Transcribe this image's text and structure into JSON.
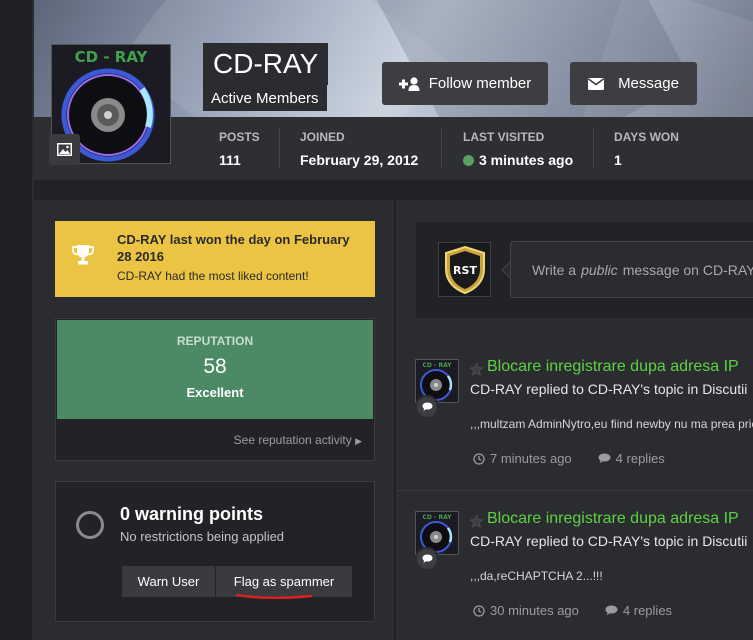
{
  "profile": {
    "name": "CD-RAY",
    "group": "Active Members",
    "avatar_text": "CD - RAY"
  },
  "header": {
    "follow_label": "Follow member",
    "message_label": "Message"
  },
  "stats": [
    {
      "label": "POSTS",
      "value": "111"
    },
    {
      "label": "JOINED",
      "value": "February 29, 2012"
    },
    {
      "label": "LAST VISITED",
      "value": "3 minutes ago"
    },
    {
      "label": "DAYS WON",
      "value": "1"
    }
  ],
  "won": {
    "title": "CD-RAY last won the day on February 28 2016",
    "subtitle": "CD-RAY had the most liked content!"
  },
  "reputation": {
    "label": "REPUTATION",
    "value": "58",
    "word": "Excellent",
    "link": "See reputation activity"
  },
  "warnings": {
    "title": "0 warning points",
    "subtitle": "No restrictions being applied",
    "warn_button": "Warn User",
    "flag_button": "Flag as spammer"
  },
  "status": {
    "avatar_text": "RST",
    "placeholder_prefix": "Write a",
    "placeholder_em": "public",
    "placeholder_suffix": "message on CD-RAY"
  },
  "feed": [
    {
      "avatar_text": "CD - RAY",
      "title": "Blocare inregistrare dupa adresa IP",
      "subtitle": "CD-RAY replied to CD-RAY's topic in Discutii",
      "snippet": ",,,multzam AdminNytro,eu fiind newby nu ma prea pricep",
      "time": "7 minutes ago",
      "replies": "4 replies"
    },
    {
      "avatar_text": "CD - RAY",
      "title": "Blocare inregistrare dupa adresa IP",
      "subtitle": "CD-RAY replied to CD-RAY's topic in Discutii",
      "snippet": ",,,da,reCHAPTCHA 2...!!!",
      "time": "30 minutes ago",
      "replies": "4 replies"
    }
  ],
  "colors": {
    "accent_green_link": "#5cd242",
    "reputation_green": "#4b8a65",
    "trophy_yellow": "#ebc443",
    "online": "#5a9e63"
  }
}
